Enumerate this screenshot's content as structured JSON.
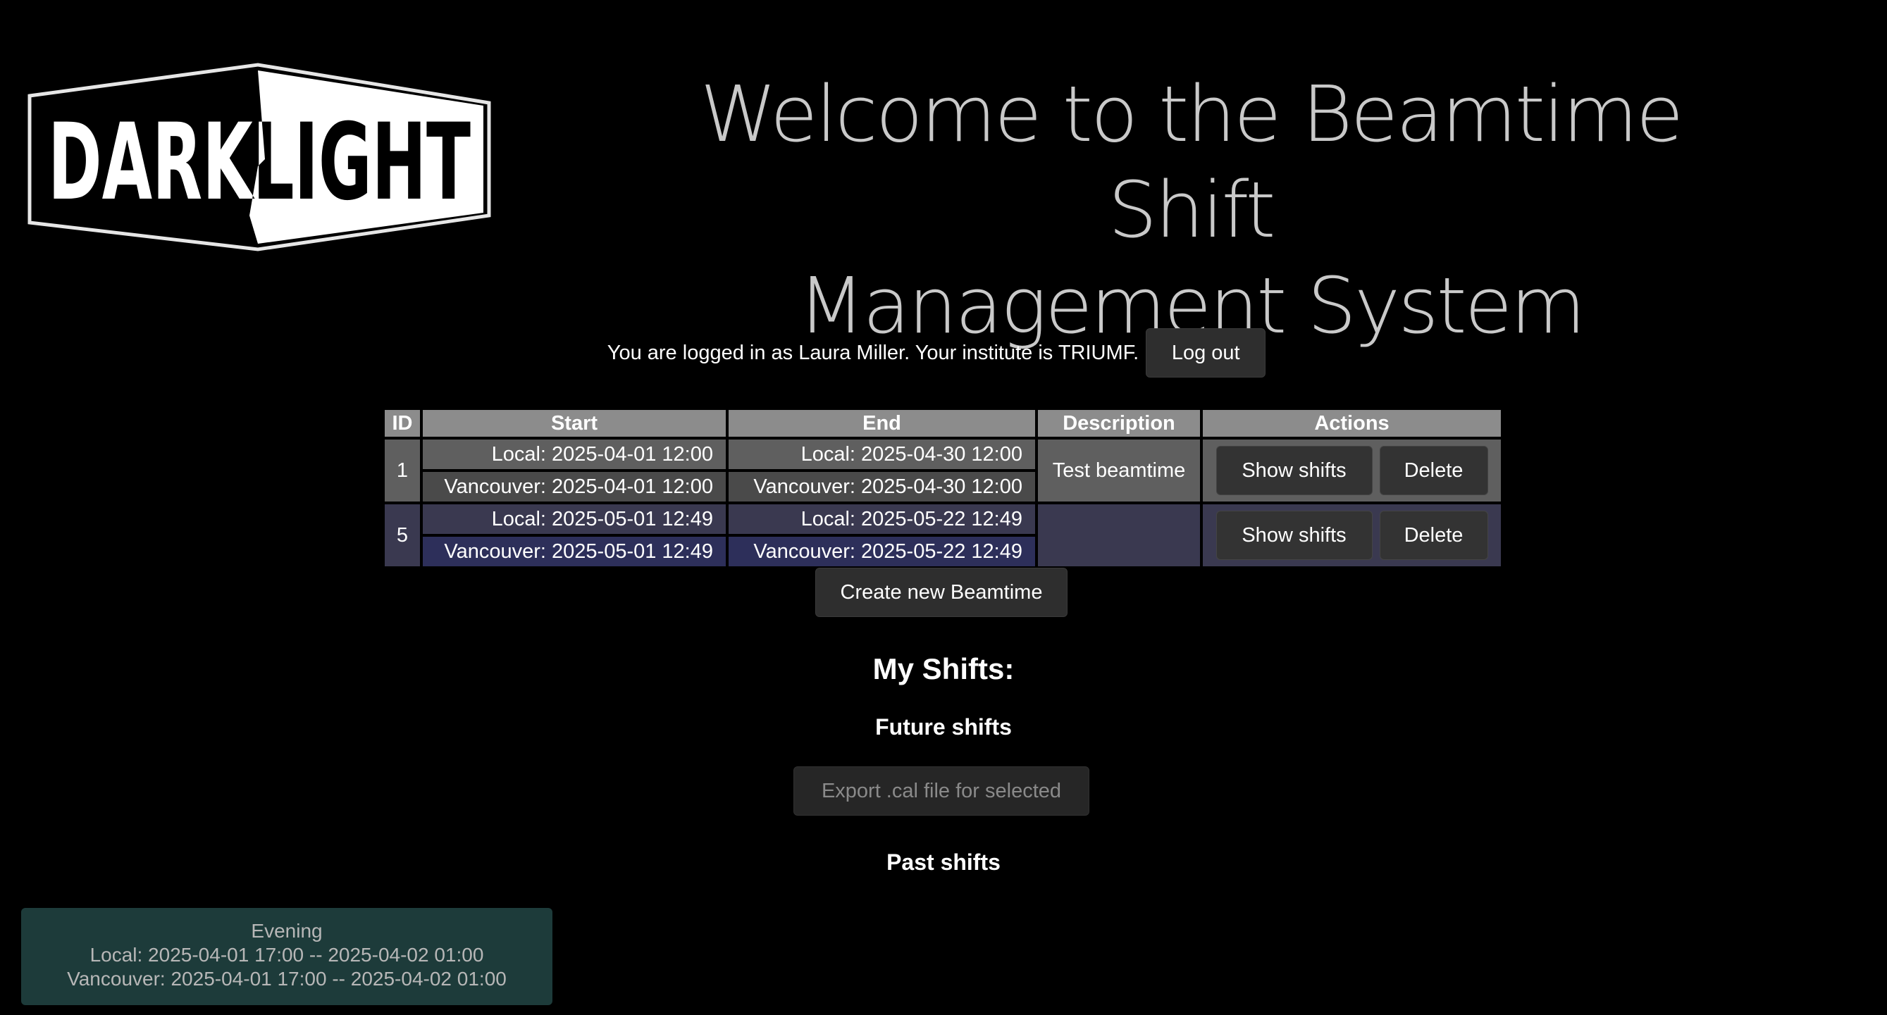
{
  "logo": {
    "text": "DARKLIGHT"
  },
  "title": {
    "line1": "Welcome to the Beamtime Shift",
    "line2": "Management System"
  },
  "login": {
    "text": "You are logged in as Laura Miller. Your institute is TRIUMF.",
    "logout_label": "Log out"
  },
  "table": {
    "headers": {
      "id": "ID",
      "start": "Start",
      "end": "End",
      "description": "Description",
      "actions": "Actions"
    },
    "rows": [
      {
        "id": "1",
        "start_local": "Local: 2025-04-01 12:00",
        "start_vancouver": "Vancouver: 2025-04-01 12:00",
        "end_local": "Local: 2025-04-30 12:00",
        "end_vancouver": "Vancouver: 2025-04-30 12:00",
        "description": "Test beamtime",
        "show_label": "Show shifts",
        "delete_label": "Delete"
      },
      {
        "id": "5",
        "start_local": "Local: 2025-05-01 12:49",
        "start_vancouver": "Vancouver: 2025-05-01 12:49",
        "end_local": "Local: 2025-05-22 12:49",
        "end_vancouver": "Vancouver: 2025-05-22 12:49",
        "description": "",
        "show_label": "Show shifts",
        "delete_label": "Delete"
      }
    ]
  },
  "create_label": "Create new Beamtime",
  "my_shifts": {
    "heading": "My Shifts:",
    "future_heading": "Future shifts",
    "export_label": "Export .cal file for selected",
    "past_heading": "Past shifts"
  },
  "shift_card": {
    "name": "Evening",
    "local": "Local: 2025-04-01 17:00 -- 2025-04-02 01:00",
    "vancouver": "Vancouver: 2025-04-01 17:00 -- 2025-04-02 01:00"
  }
}
